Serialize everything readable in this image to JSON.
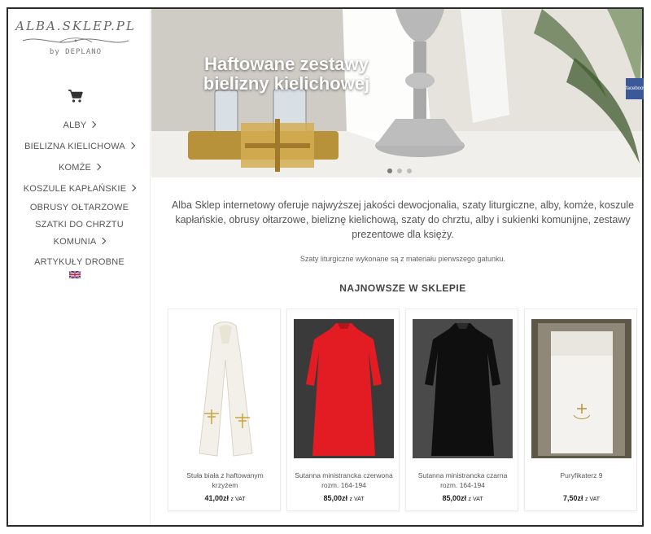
{
  "logo": {
    "main": "ALBA.SKLEP.PL",
    "sub": "by DEPLANO"
  },
  "cart": {
    "icon": "cart-icon"
  },
  "menu": {
    "items": [
      {
        "label": "ALBY",
        "has_submenu": true
      },
      {
        "label": "BIELIZNA KIELICHOWA",
        "has_submenu": true
      },
      {
        "label": "KOMŻE",
        "has_submenu": true
      },
      {
        "label": "KOSZULE KAPŁAŃSKIE",
        "has_submenu": true
      },
      {
        "label": "OBRUSY OŁTARZOWE",
        "has_submenu": false
      },
      {
        "label": "SZATKI DO CHRZTU",
        "has_submenu": false
      },
      {
        "label": "KOMUNIA",
        "has_submenu": true
      },
      {
        "label": "ARTYKUŁY DROBNE",
        "has_submenu": false
      }
    ],
    "flag_icon": "uk-flag-icon"
  },
  "banner": {
    "title_line1": "Haftowane zestawy",
    "title_line2": "bielizny kielichowej",
    "active_slide": 1,
    "slide_count": 3
  },
  "facebook_tab": {
    "label": "facebook"
  },
  "intro": {
    "text": "Alba Sklep internetowy oferuje najwyższej jakości dewocjonalia, szaty liturgiczne, alby, komże, koszule kapłańskie, obrusy ołtarzowe, bieliznę kielichową, szaty do chrztu, alby i sukienki komunijne, zestawy prezentowe dla księży.",
    "subtext": "Szaty liturgiczne wykonane są z materiału pierwszego gatunku."
  },
  "section": {
    "title": "NAJNOWSZE W SKLEPIE"
  },
  "products": [
    {
      "name": "Stuła biała z haftowanym krzyżem",
      "price": "41,00zł",
      "vat": "z VAT",
      "image": "white-stole"
    },
    {
      "name": "Sutanna ministrancka czerwona rozm. 164-194",
      "price": "85,00zł",
      "vat": "z VAT",
      "image": "red-cassock"
    },
    {
      "name": "Sutanna ministrancka czarna rozm. 164-194",
      "price": "85,00zł",
      "vat": "z VAT",
      "image": "black-cassock"
    },
    {
      "name": "Puryfikaterz 9",
      "price": "7,50zł",
      "vat": "z VAT",
      "image": "purificator"
    }
  ],
  "colors": {
    "accent": "#3b5998",
    "text": "#555555",
    "sidebar_border": "#ececec"
  }
}
